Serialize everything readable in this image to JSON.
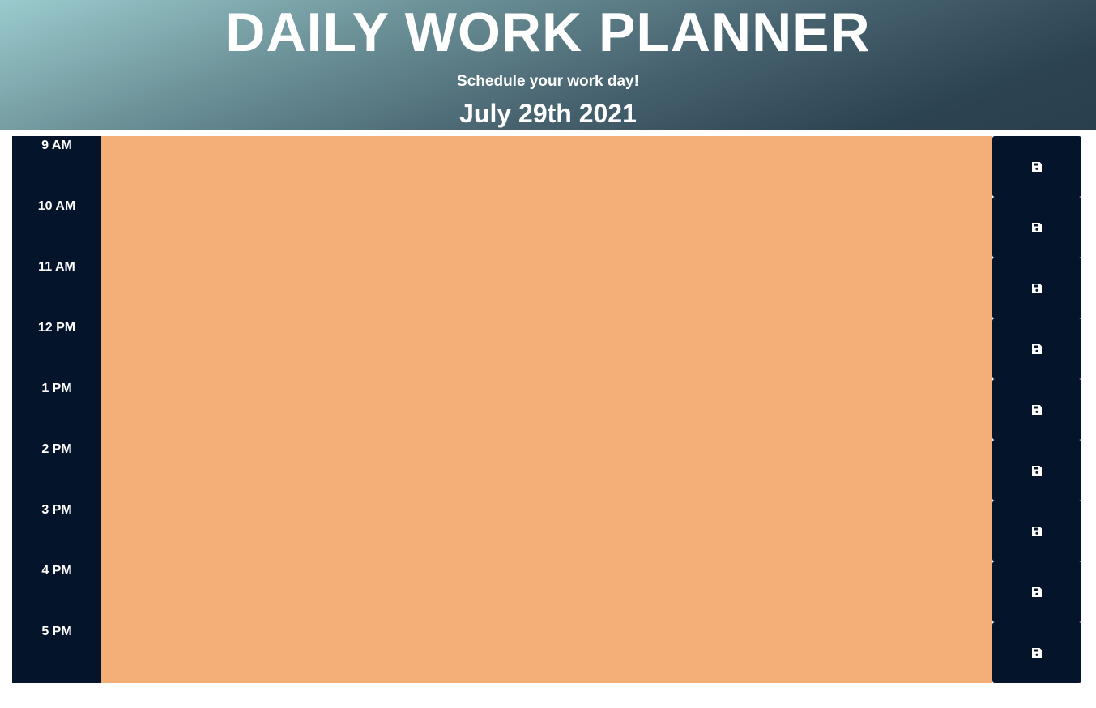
{
  "header": {
    "title": "DAILY WORK PLANNER",
    "subtitle": "Schedule your work day!",
    "date": "July 29th 2021"
  },
  "timeblocks": [
    {
      "hour": "9 AM",
      "task": "",
      "save_icon": "floppy-disk-icon"
    },
    {
      "hour": "10 AM",
      "task": "",
      "save_icon": "floppy-disk-icon"
    },
    {
      "hour": "11 AM",
      "task": "",
      "save_icon": "floppy-disk-icon"
    },
    {
      "hour": "12 PM",
      "task": "",
      "save_icon": "floppy-disk-icon"
    },
    {
      "hour": "1 PM",
      "task": "",
      "save_icon": "floppy-disk-icon"
    },
    {
      "hour": "2 PM",
      "task": "",
      "save_icon": "floppy-disk-icon"
    },
    {
      "hour": "3 PM",
      "task": "",
      "save_icon": "floppy-disk-icon"
    },
    {
      "hour": "4 PM",
      "task": "",
      "save_icon": "floppy-disk-icon"
    },
    {
      "hour": "5 PM",
      "task": "",
      "save_icon": "floppy-disk-icon"
    }
  ],
  "colors": {
    "hour_bg": "#04152b",
    "future_task_bg": "#f4af79",
    "save_button_bg": "#04152b",
    "header_gradient_start": "#9bcbce",
    "header_gradient_end": "#2a3f4e"
  }
}
